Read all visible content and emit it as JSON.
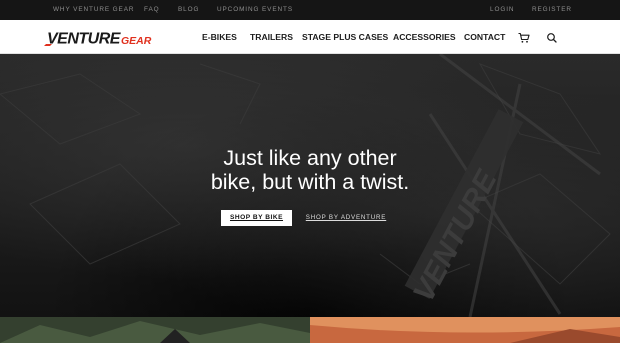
{
  "topbar": {
    "left_links": [
      "WHY VENTURE GEAR",
      "FAQ",
      "BLOG",
      "UPCOMING EVENTS"
    ],
    "right_links": [
      "LOGIN",
      "REGISTER"
    ]
  },
  "brand": {
    "logo_main": "VENTURE",
    "logo_sub": "GEAR",
    "colors": {
      "primary": "#1a1a1a",
      "accent": "#e0301e"
    }
  },
  "nav": {
    "items": [
      "E-BIKES",
      "TRAILERS",
      "STAGE PLUS CASES",
      "ACCESSORIES",
      "CONTACT"
    ],
    "icons": [
      "cart-icon",
      "search-icon"
    ]
  },
  "hero": {
    "headline_line1": "Just like any other",
    "headline_line2": "bike, but with a twist.",
    "primary_button": "SHOP BY BIKE",
    "secondary_button": "SHOP BY ADVENTURE"
  }
}
